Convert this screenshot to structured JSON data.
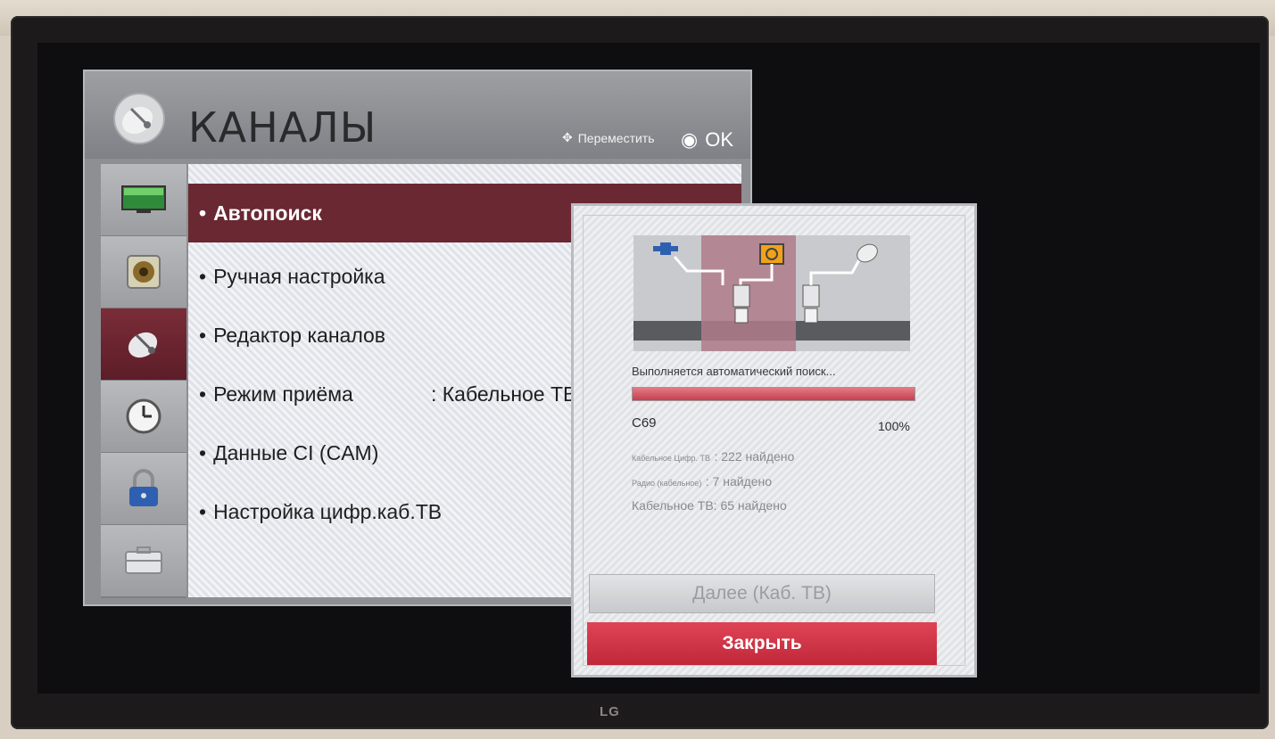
{
  "menu": {
    "title": "КАНАЛЫ",
    "icon": "satellite-dish-icon",
    "hint_move": "Переместить",
    "hint_ok": "OK",
    "sidebar": [
      {
        "icon": "picture-icon"
      },
      {
        "icon": "speaker-icon"
      },
      {
        "icon": "satellite-dish-icon",
        "active": true
      },
      {
        "icon": "clock-icon"
      },
      {
        "icon": "lock-icon"
      },
      {
        "icon": "toolbox-icon"
      }
    ],
    "items": [
      {
        "label": "Автопоиск",
        "selected": true
      },
      {
        "label": "Ручная настройка"
      },
      {
        "label": "Редактор каналов"
      },
      {
        "label": "Режим приёма",
        "value": ": Кабельное ТВ"
      },
      {
        "label": "Данные CI (CAM)"
      },
      {
        "label": "Настройка цифр.каб.ТВ"
      }
    ]
  },
  "popup": {
    "status": "Выполняется автоматический поиск...",
    "progress_percent": 100,
    "channel": "C69",
    "percent_label": "100%",
    "stats": [
      {
        "label": "Кабельное Цифр. ТВ",
        "count": ": 222 найдено"
      },
      {
        "label": "Радио (кабельное)",
        "count": ": 7 найдено"
      },
      {
        "label": "Кабельное ТВ",
        "count": ": 65 найдено"
      }
    ],
    "next_button": "Далее (Каб. ТВ)",
    "close_button": "Закрыть"
  },
  "tv": {
    "brand": "LG"
  },
  "colors": {
    "accent": "#6a2833",
    "close": "#c8384a",
    "progress": "#d04c5a"
  }
}
